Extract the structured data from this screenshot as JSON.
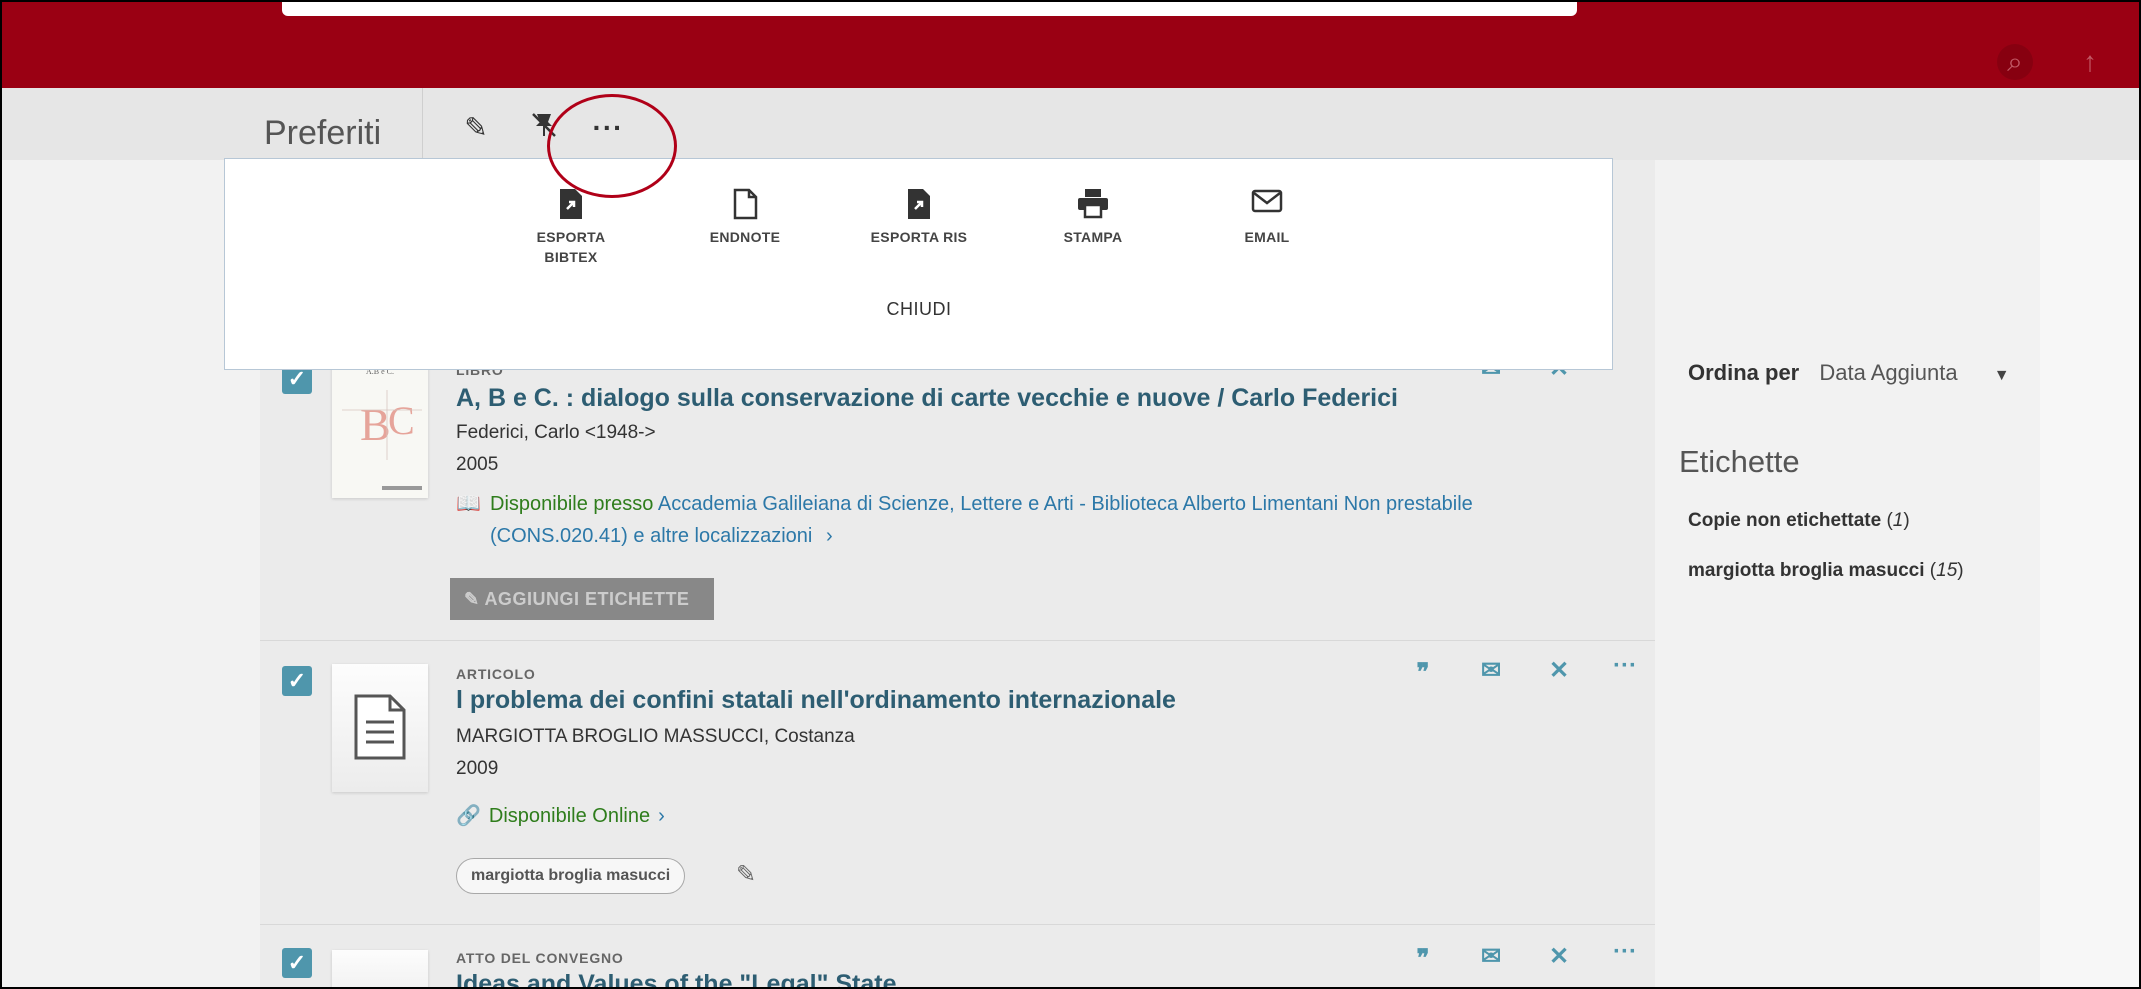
{
  "header": {
    "search_icon": "search-icon",
    "up_icon": "arrow-up-icon"
  },
  "toolbar": {
    "title": "Preferiti",
    "edit_icon": "pencil-icon",
    "unpin_icon": "unpin-icon",
    "more_label": "···"
  },
  "export_popup": {
    "buttons": [
      {
        "label": "ESPORTA BIBTEX",
        "icon": "file-export-icon"
      },
      {
        "label": "ENDNOTE",
        "icon": "file-icon"
      },
      {
        "label": "ESPORTA RIS",
        "icon": "file-export-icon"
      },
      {
        "label": "STAMPA",
        "icon": "printer-icon"
      },
      {
        "label": "EMAIL",
        "icon": "mail-icon"
      }
    ],
    "close_label": "CHIUDI"
  },
  "records": [
    {
      "type": "LIBRO",
      "title": "A, B e C. : dialogo sulla conservazione di carte vecchie e nuove / Carlo Federici",
      "author": "Federici, Carlo <1948->",
      "year": "2005",
      "availability_prefix": "Disponibile presso",
      "availability_location": "Accademia Galileiana di Scienze, Lettere e Arti - Biblioteca Alberto Limentani  Non prestabile (CONS.020.41) e altre localizzazioni",
      "add_tags_label": "AGGIUNGI ETICHETTE"
    },
    {
      "type": "ARTICOLO",
      "title": "l problema dei confini statali nell'ordinamento internazionale",
      "author": "MARGIOTTA BROGLIO MASSUCCI, Costanza",
      "year": "2009",
      "availability": "Disponibile Online",
      "tag": "margiotta broglia masucci"
    },
    {
      "type": "ATTO DEL CONVEGNO",
      "title": "Ideas and Values of the \"Legal\" State"
    }
  ],
  "record_actions": {
    "cite_icon": "quote-icon",
    "email_icon": "mail-icon",
    "unpin_icon": "unpin-icon",
    "more_label": "···"
  },
  "sidebar": {
    "sort_label": "Ordina per",
    "sort_value": "Data Aggiunta",
    "tags_heading": "Etichette",
    "tags": [
      {
        "name": "Copie non etichettate",
        "count": "1"
      },
      {
        "name": "margiotta broglia masucci",
        "count": "15"
      }
    ]
  },
  "colors": {
    "header": "#9a0013",
    "accent": "#4f96ac",
    "title_link": "#2d5d72",
    "available": "#2f7d1c",
    "link": "#2c78a8"
  }
}
